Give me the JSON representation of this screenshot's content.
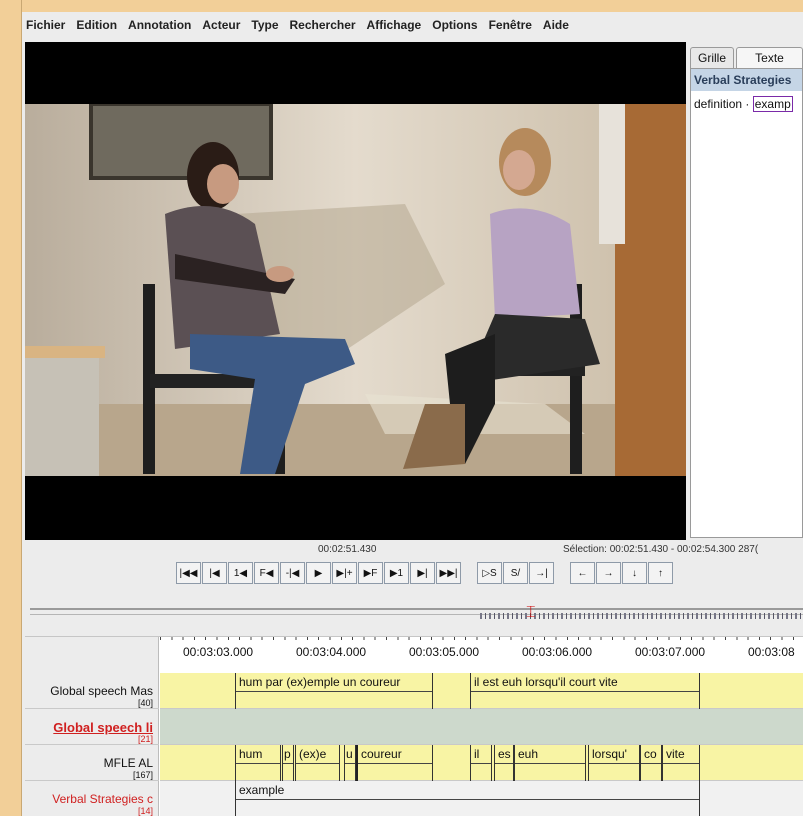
{
  "menu": [
    "Fichier",
    "Edition",
    "Annotation",
    "Acteur",
    "Type",
    "Rechercher",
    "Affichage",
    "Options",
    "Fenêtre",
    "Aide"
  ],
  "right_panel": {
    "tabs": [
      "Grille",
      "Texte"
    ],
    "header": "Verbal Strategies",
    "line_prefix": "definition ·",
    "line_highlight": "examp"
  },
  "time": {
    "current": "00:02:51.430",
    "selection": "Sélection: 00:02:51.430 - 00:02:54.300  287("
  },
  "controls": [
    "|◀◀",
    "|◀",
    "1◀",
    "F◀",
    "-|◀",
    "▶",
    "▶|+",
    "▶F",
    "▶1",
    "▶|",
    "▶▶|",
    "▷S",
    "S/",
    "→|",
    "←",
    "→",
    "↓",
    "↑"
  ],
  "ruler": [
    "00:03:03.000",
    "00:03:04.000",
    "00:03:05.000",
    "00:03:06.000",
    "00:03:07.000",
    "00:03:08"
  ],
  "tiers": [
    {
      "name": "Global speech Mas",
      "count": "[40]",
      "color": "#111111",
      "bold": false
    },
    {
      "name": "Global speech li",
      "count": "[21]",
      "color": "#d02020",
      "bold": true
    },
    {
      "name": "MFLE AL",
      "count": "[167]",
      "color": "#111111",
      "bold": false
    },
    {
      "name": "Verbal Strategies c",
      "count": "[14]",
      "color": "#d02020",
      "bold": false
    }
  ],
  "annotations": {
    "tier1": [
      "hum par (ex)emple un coureur",
      "il est euh lorsqu'il court vite"
    ],
    "tier3": [
      "hum",
      "p",
      "(ex)e",
      "u",
      "coureur",
      "il",
      "es",
      "euh",
      "lorsqu'",
      "co",
      "vite"
    ],
    "tier4": [
      "example"
    ]
  }
}
